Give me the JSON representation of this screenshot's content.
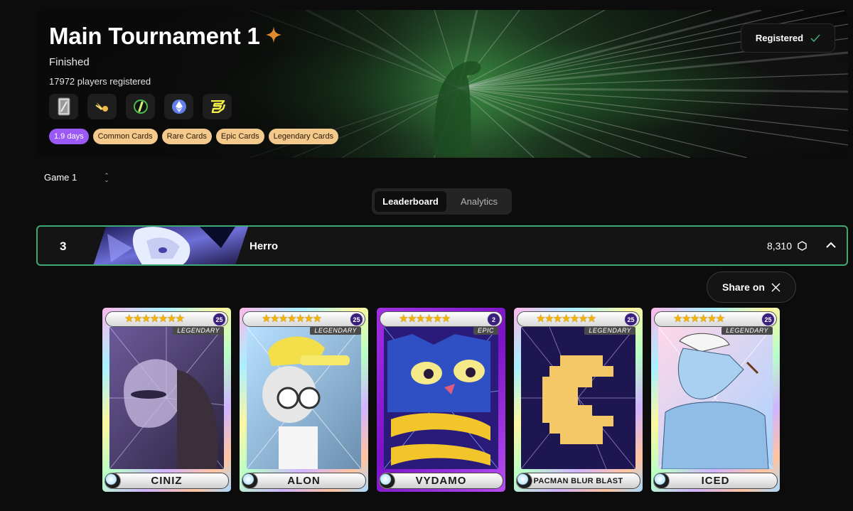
{
  "tournament": {
    "title": "Main Tournament 1",
    "status": "Finished",
    "players": "17972 players registered",
    "registered_label": "Registered",
    "chain_icons": [
      "card-deck-icon",
      "blast-icon",
      "zksync-icon",
      "ethereum-icon",
      "blast-logo-icon"
    ],
    "chips": [
      "1.9 days",
      "Common Cards",
      "Rare Cards",
      "Epic Cards",
      "Legendary Cards"
    ]
  },
  "game_select": {
    "value": "Game 1"
  },
  "tabs": {
    "leaderboard": "Leaderboard",
    "analytics": "Analytics"
  },
  "leaderboard_row": {
    "rank": "3",
    "name": "Herro",
    "score": "8,310"
  },
  "share": {
    "label": "Share on"
  },
  "cards": [
    {
      "name": "CINIZ",
      "rarity": "LEGENDARY",
      "level": "25",
      "stars": 7
    },
    {
      "name": "ALON",
      "rarity": "LEGENDARY",
      "level": "25",
      "stars": 7
    },
    {
      "name": "VYDAMO",
      "rarity": "EPIC",
      "level": "2",
      "stars": 6
    },
    {
      "name": "PACMAN BLUR BLAST",
      "rarity": "LEGENDARY",
      "level": "25",
      "stars": 7
    },
    {
      "name": "ICED",
      "rarity": "LEGENDARY",
      "level": "25",
      "stars": 6
    }
  ],
  "colors": {
    "accent_green": "#3ea874",
    "chip_orange": "#f3c98c",
    "chip_purple": "#9b59f7",
    "star_gold": "#f5b400"
  }
}
